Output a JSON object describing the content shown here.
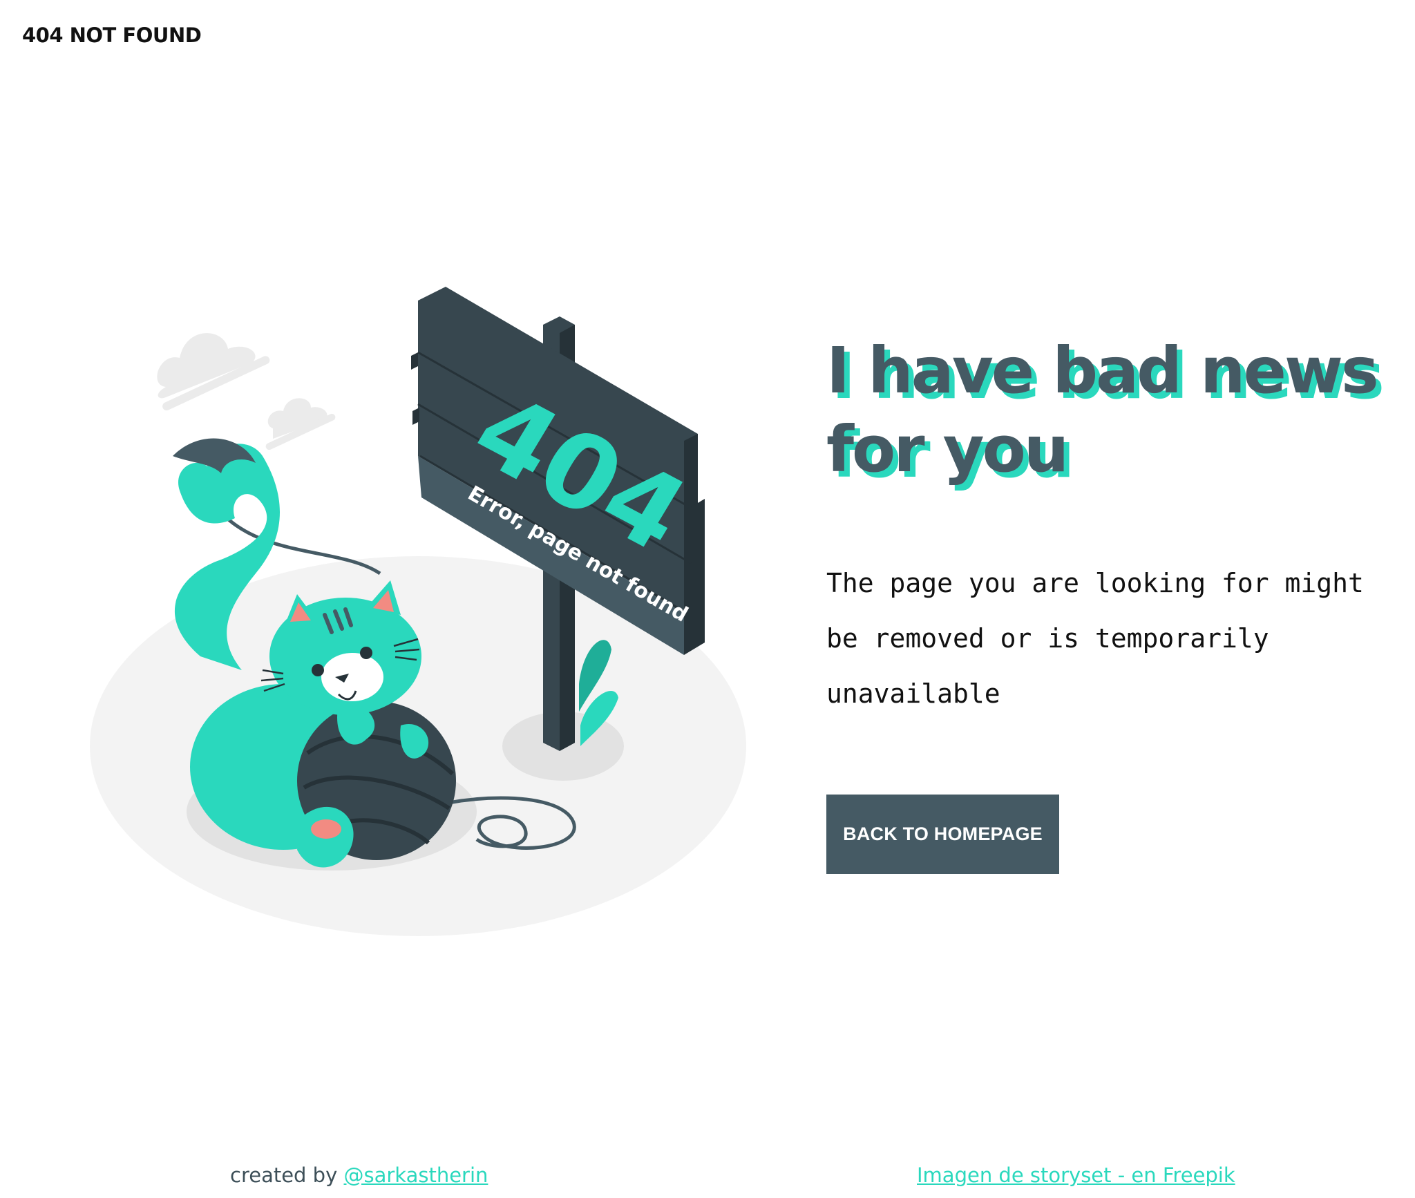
{
  "header": {
    "title": "404 NOT FOUND"
  },
  "illustration": {
    "sign_number": "404",
    "sign_text": "Error, page not found"
  },
  "main": {
    "headline_line1": "I have bad news",
    "headline_line2": "for you",
    "message_line1": "The page you are looking for might",
    "message_line2": "be removed or is temporarily",
    "message_line3": "unavailable",
    "button_label": "BACK TO HOMEPAGE"
  },
  "footer": {
    "credit_prefix": "created by",
    "credit_link": "@sarkastherin",
    "attribution_link": "Imagen de storyset - en Freepik"
  },
  "colors": {
    "accent": "#2ad8bd",
    "dark": "#455a64",
    "text": "#111111"
  }
}
